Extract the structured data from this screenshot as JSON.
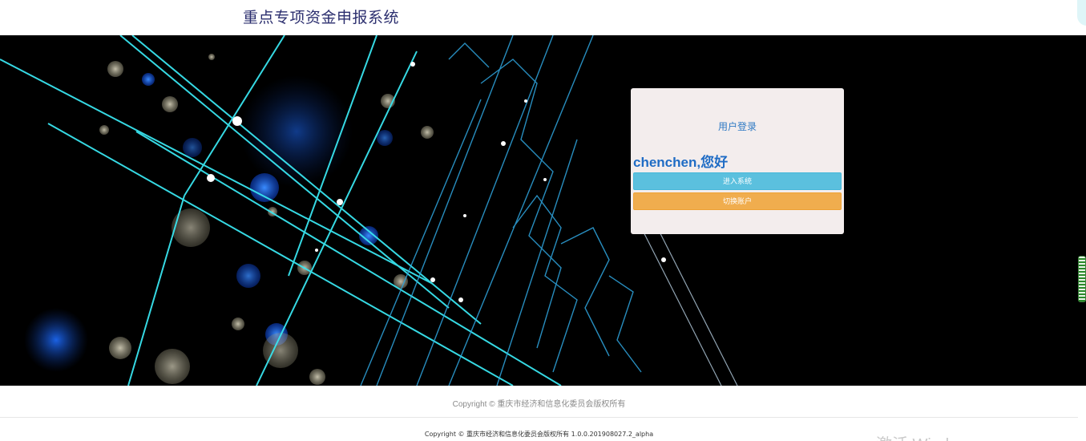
{
  "header": {
    "title": "重点专项资金申报系统"
  },
  "login": {
    "title": "用户登录",
    "greeting": "chenchen,您好",
    "enter_label": "进入系统",
    "switch_label": "切换账户"
  },
  "footer": {
    "copyright": "Copyright © 重庆市经济和信息化委员会版权所有",
    "version_line": "Copyright © 重庆市经济和信息化委员会版权所有 1.0.0.201908027.2_alpha"
  },
  "os_watermark": "激活 Windows",
  "colors": {
    "title": "#2b2e6e",
    "enter_button": "#5bc0de",
    "switch_button": "#f0ad4e",
    "panel_bg": "#f3eded",
    "greeting": "#1f6cc5",
    "banner_line": "#39e5f0"
  },
  "icons": [
    "banner-image"
  ]
}
